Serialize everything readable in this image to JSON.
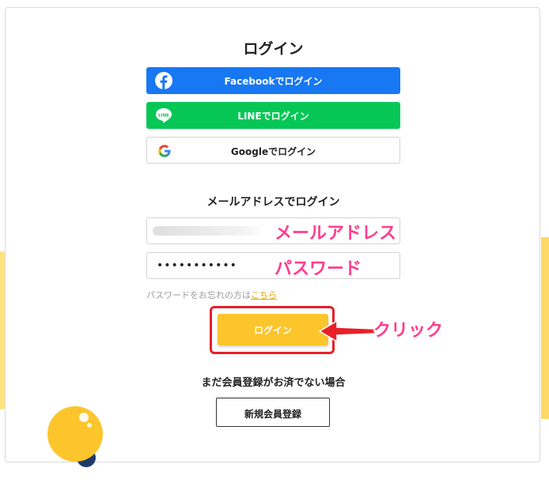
{
  "colors": {
    "facebook": "#1877f2",
    "line": "#06c755",
    "login_button": "#fcc52c",
    "annotation": "#ff3d8d",
    "highlight": "#e8202a",
    "link": "#e0a800"
  },
  "page": {
    "title": "ログイン"
  },
  "sns": {
    "facebook": {
      "label": "Facebookでログイン",
      "icon": "facebook-icon"
    },
    "line": {
      "label": "LINEでログイン",
      "icon": "line-icon",
      "icon_text": "LINE"
    },
    "google": {
      "label": "Googleでログイン",
      "icon": "google-icon"
    }
  },
  "email_section": {
    "heading": "メールアドレスでログイン"
  },
  "form": {
    "password_value": "•••••••••••",
    "forgot_text": "パスワードをお忘れの方は",
    "forgot_link": "こちら",
    "login_button": "ログイン"
  },
  "annotations": {
    "email": "メールアドレス",
    "password": "パスワード",
    "click": "クリック"
  },
  "register": {
    "heading": "まだ会員登録がお済でない場合",
    "button": "新規会員登録"
  }
}
